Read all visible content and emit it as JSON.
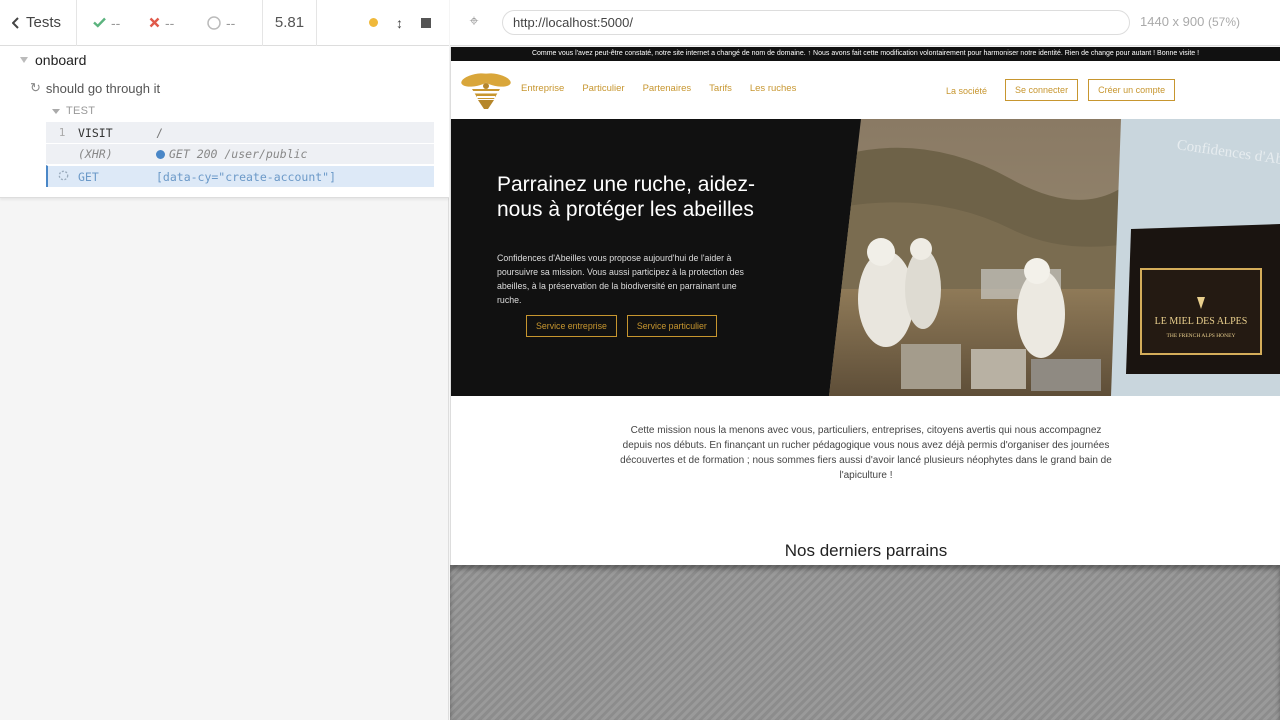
{
  "runner": {
    "tests_label": "Tests",
    "passed": "--",
    "failed": "--",
    "pending": "--",
    "duration": "5.81",
    "suite_title": "onboard",
    "test_title": "should go through it",
    "section_label": "TEST",
    "commands": [
      {
        "num": "1",
        "name": "VISIT",
        "message": "/"
      },
      {
        "num": "",
        "name": "(XHR)",
        "message": "GET 200 /user/public"
      },
      {
        "num": "",
        "name": "GET",
        "message": "[data-cy=\"create-account\"]"
      }
    ],
    "colors": {
      "pass": "#5bb37e",
      "fail": "#e05a4b",
      "running": "#f0b93b",
      "xhr": "#4a87c7"
    }
  },
  "aut": {
    "url": "http://localhost:5000/",
    "viewport_size": "1440 x 900",
    "viewport_scale": "(57%)"
  },
  "site": {
    "announcement": "Comme vous l'avez peut-être constaté, notre site internet a changé de nom de domaine. ↑ Nous avons fait cette modification volontairement pour harmoniser notre identité. Rien de change pour autant ! Bonne visite !",
    "nav_links": [
      "Entreprise",
      "Particulier",
      "Partenaires",
      "Tarifs",
      "Les ruches"
    ],
    "society_link": "La société",
    "login_button": "Se connecter",
    "signup_button": "Créer un compte",
    "hero_title": "Parrainez une ruche, aidez-nous à protéger les abeilles",
    "hero_text": "Confidences d'Abeilles vous propose aujourd'hui de l'aider à poursuivre sa mission. Vous aussi participez à la protection des abeilles, à la préservation de la biodiversité en parrainant une ruche.",
    "hero_button_company": "Service entreprise",
    "hero_button_private": "Service particulier",
    "banner_brand": "Confidences d'Abeilles",
    "banner_product": "LE MIEL DES ALPES",
    "banner_subtitle": "THE FRENCH ALPS HONEY",
    "mission_text": "Cette mission nous la menons avec vous, particuliers, entreprises, citoyens avertis qui nous accompagnez depuis nos débuts. En finançant un rucher pédagogique vous nous avez déjà permis d'organiser des journées découvertes et de formation ; nous sommes fiers aussi d'avoir lancé plusieurs néophytes dans le grand bain de l'apiculture !",
    "section_title": "Nos derniers parrains",
    "brand_color": "#c7962f"
  }
}
